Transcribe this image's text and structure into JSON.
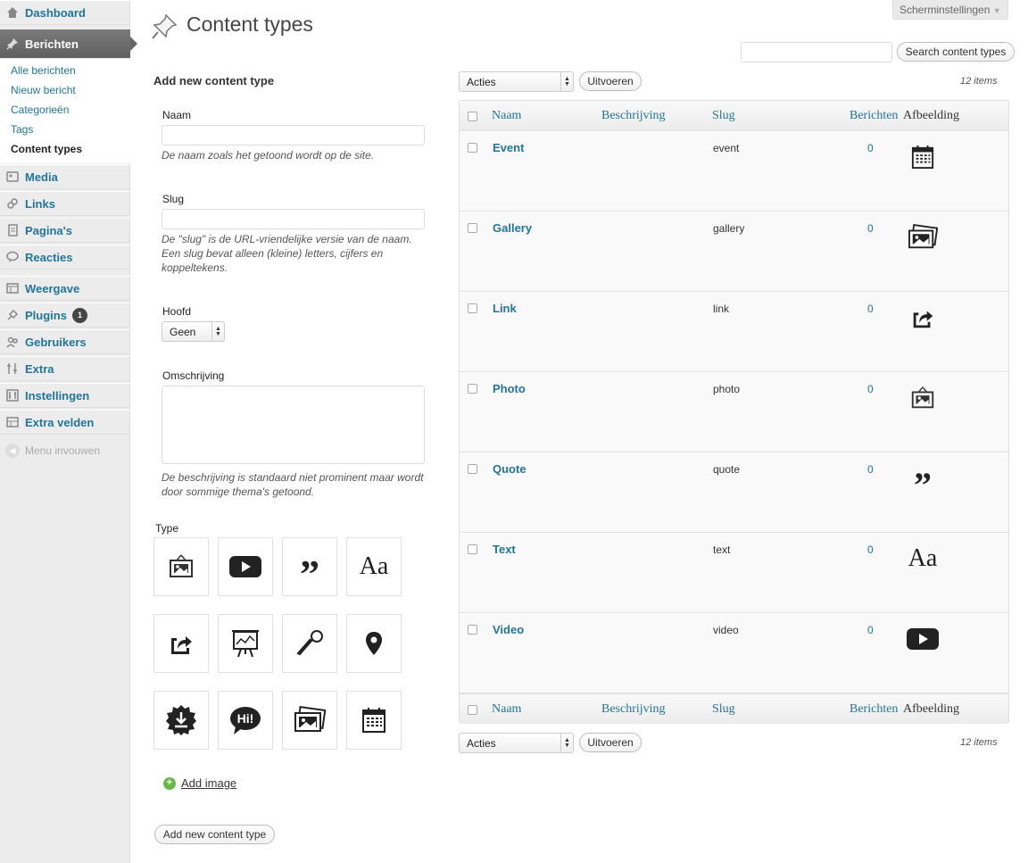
{
  "sidebar": {
    "items": [
      {
        "label": "Dashboard",
        "icon": "dashboard-icon"
      },
      {
        "label": "Berichten",
        "icon": "pin-icon",
        "active": true
      },
      {
        "label": "Media",
        "icon": "media-icon"
      },
      {
        "label": "Links",
        "icon": "links-icon"
      },
      {
        "label": "Pagina's",
        "icon": "pages-icon"
      },
      {
        "label": "Reacties",
        "icon": "comments-icon"
      },
      {
        "label": "Weergave",
        "icon": "appearance-icon"
      },
      {
        "label": "Plugins",
        "icon": "plugins-icon",
        "badge": "1"
      },
      {
        "label": "Gebruikers",
        "icon": "users-icon"
      },
      {
        "label": "Extra",
        "icon": "tools-icon"
      },
      {
        "label": "Instellingen",
        "icon": "settings-icon"
      },
      {
        "label": "Extra velden",
        "icon": "fields-icon"
      }
    ],
    "submenu": [
      "Alle berichten",
      "Nieuw bericht",
      "Categorieën",
      "Tags",
      "Content types"
    ],
    "collapse_label": "Menu invouwen"
  },
  "header": {
    "title": "Content types",
    "screen_options": "Scherminstellingen",
    "search_button": "Search content types"
  },
  "form": {
    "heading": "Add new content type",
    "name_label": "Naam",
    "name_desc": "De naam zoals het getoond wordt op de site.",
    "slug_label": "Slug",
    "slug_desc": "De \"slug\" is de URL-vriendelijke versie van de naam. Een slug bevat alleen (kleine) letters, cijfers en koppeltekens.",
    "parent_label": "Hoofd",
    "parent_value": "Geen",
    "description_label": "Omschrijving",
    "description_desc": "De beschrijving is standaard niet prominent maar wordt door sommige thema's getoond.",
    "type_label": "Type",
    "type_icons": [
      "photo-icon",
      "video-icon",
      "quote-icon",
      "text-icon",
      "link-icon",
      "presentation-icon",
      "microphone-icon",
      "location-icon",
      "download-icon",
      "speech-bubble-icon",
      "gallery-icon",
      "calendar-icon"
    ],
    "type_text_glyph": "Aa",
    "speech_text": "Hi!",
    "add_image": "Add image",
    "submit": "Add new content type"
  },
  "table": {
    "bulk_action": "Acties",
    "apply": "Uitvoeren",
    "items_count": "12 items",
    "columns": [
      "Naam",
      "Beschrijving",
      "Slug",
      "Berichten",
      "Afbeelding"
    ],
    "rows": [
      {
        "name": "Event",
        "slug": "event",
        "count": "0",
        "icon": "calendar-icon"
      },
      {
        "name": "Gallery",
        "slug": "gallery",
        "count": "0",
        "icon": "gallery-icon"
      },
      {
        "name": "Link",
        "slug": "link",
        "count": "0",
        "icon": "link-icon"
      },
      {
        "name": "Photo",
        "slug": "photo",
        "count": "0",
        "icon": "photo-icon"
      },
      {
        "name": "Quote",
        "slug": "quote",
        "count": "0",
        "icon": "quote-icon"
      },
      {
        "name": "Text",
        "slug": "text",
        "count": "0",
        "icon": "text-icon"
      },
      {
        "name": "Video",
        "slug": "video",
        "count": "0",
        "icon": "video-icon"
      }
    ]
  },
  "colors": {
    "link": "#21759b",
    "sidebar_bg": "#ececec",
    "active_menu": "#6d6d6d"
  }
}
